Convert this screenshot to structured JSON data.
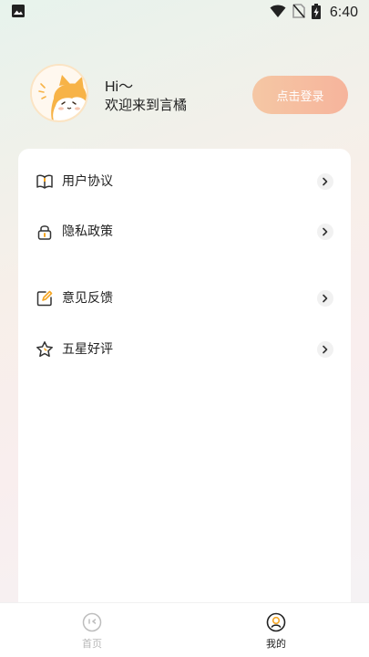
{
  "status_bar": {
    "time": "6:40",
    "icons": [
      "image-icon",
      "wifi-icon",
      "no-sim-icon",
      "battery-charging-icon"
    ]
  },
  "profile": {
    "greeting": "Hi〜",
    "welcome": "欢迎来到言橘",
    "login_label": "点击登录",
    "avatar": "cat-avatar"
  },
  "menu": {
    "items": [
      {
        "label": "用户协议",
        "icon": "book-icon"
      },
      {
        "label": "隐私政策",
        "icon": "lock-icon"
      },
      {
        "label": "意见反馈",
        "icon": "edit-icon"
      },
      {
        "label": "五星好评",
        "icon": "star-icon"
      }
    ]
  },
  "tabs": [
    {
      "label": "首页",
      "icon": "home-icon",
      "active": false
    },
    {
      "label": "我的",
      "icon": "profile-icon",
      "active": true
    }
  ],
  "colors": {
    "accent": "#f6b49c",
    "active_tab": "#222222",
    "inactive_tab": "#b8b8b8",
    "avatar_orange": "#f7b347"
  }
}
